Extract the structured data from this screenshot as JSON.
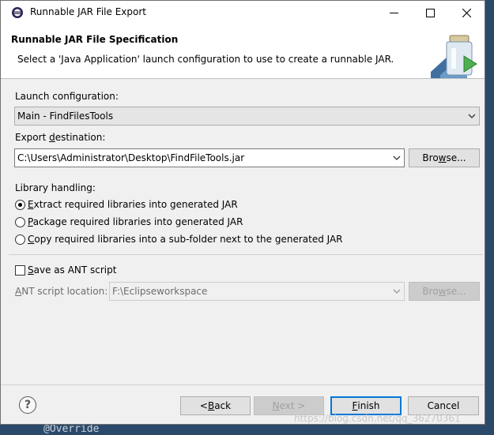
{
  "window": {
    "title": "Runnable JAR File Export"
  },
  "banner": {
    "title": "Runnable JAR File Specification",
    "description": "Select a 'Java Application' launch configuration to use to create a runnable JAR."
  },
  "launch": {
    "label": "Launch configuration:",
    "value": "Main - FindFilesTools"
  },
  "export": {
    "label_pre": "Export ",
    "label_mn": "d",
    "label_post": "estination:",
    "value": "C:\\Users\\Administrator\\Desktop\\FindFileTools.jar",
    "browse_pre": "Bro",
    "browse_mn": "w",
    "browse_post": "se..."
  },
  "library": {
    "label": "Library handling:",
    "options": [
      {
        "mn": "E",
        "rest": "xtract required libraries into generated JAR",
        "checked": true
      },
      {
        "mn": "P",
        "rest": "ackage required libraries into generated JAR",
        "checked": false
      },
      {
        "mn": "C",
        "rest": "opy required libraries into a sub-folder next to the generated JAR",
        "checked": false
      }
    ]
  },
  "ant": {
    "checkbox_mn": "S",
    "checkbox_rest": "ave as ANT script",
    "location_mn": "A",
    "location_rest": "NT script location:",
    "value": "F:\\Eclipseworkspace",
    "browse_pre": "Bro",
    "browse_mn": "w",
    "browse_post": "se..."
  },
  "buttons": {
    "back_pre": "< ",
    "back_mn": "B",
    "back_post": "ack",
    "next_mn": "N",
    "next_post": "ext >",
    "finish_mn": "F",
    "finish_post": "inish",
    "cancel": "Cancel"
  },
  "background": {
    "code": "@Override",
    "watermark": "https://blog.csdn.net/qq_36270361"
  }
}
